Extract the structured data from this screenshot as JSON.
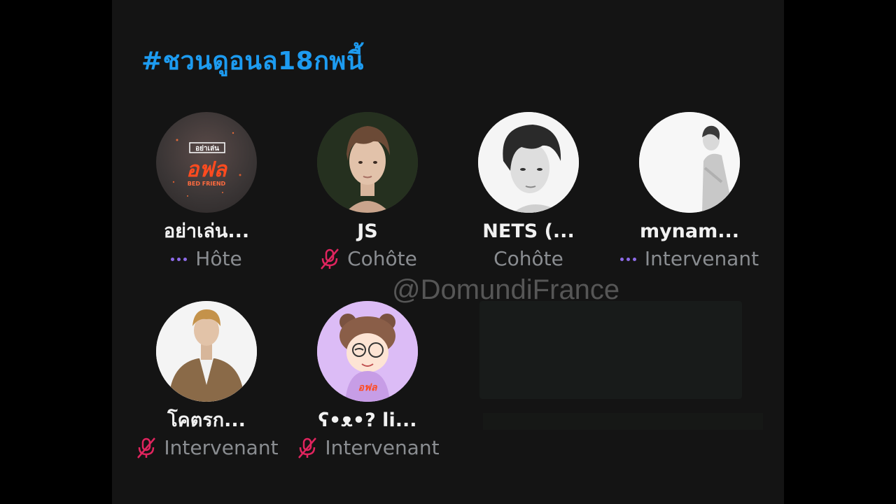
{
  "hashtag": "#ชวนดูอนล18กพนี้",
  "watermark": "@DomundiFrance",
  "speakers": [
    {
      "name": "อย่าเล่น...",
      "role": "Hôte",
      "indicator": "speaking-dots",
      "avatar_text_top": "อย่าเล่น",
      "avatar_text_main": "อฟล",
      "avatar_text_sub": "BED FRIEND"
    },
    {
      "name": "JS",
      "role": "Cohôte",
      "indicator": "mic-muted-icon"
    },
    {
      "name": "NETS (...",
      "role": "Cohôte",
      "indicator": "none"
    },
    {
      "name": "mynam...",
      "role": "Intervenant",
      "indicator": "speaking-dots"
    },
    {
      "name": "โคตรก...",
      "role": "Intervenant",
      "indicator": "mic-muted-icon"
    },
    {
      "name": "ʕ•ᴥ•? li...",
      "role": "Intervenant",
      "indicator": "mic-muted-icon",
      "avatar_text_main": "อฟล"
    }
  ],
  "colors": {
    "background": "#141414",
    "hashtag": "#1d9bf0",
    "muted_mic": "#e0245e",
    "speaking_dots": "#8d6be8",
    "role_text": "#8a8d91",
    "name_text": "#f1f1f1"
  }
}
